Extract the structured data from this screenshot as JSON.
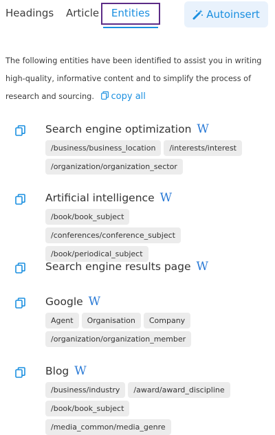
{
  "tabs": [
    {
      "label": "Headings"
    },
    {
      "label": "Article"
    },
    {
      "label": "Entities"
    }
  ],
  "autoinsert": {
    "label": "Autoinsert"
  },
  "intro": {
    "text": "The following entities have been identified to assist you in writing high-quality, informative content and to simplify the process of research and sourcing.",
    "copy_all": "copy all"
  },
  "wiki_label": "W",
  "entities": [
    {
      "name": "Search engine optimization",
      "tags": [
        "/business/business_location",
        "/interests/interest",
        "/organization/organization_sector"
      ]
    },
    {
      "name": "Artificial intelligence",
      "tags": [
        "/book/book_subject",
        "/conferences/conference_subject",
        "/book/periodical_subject"
      ]
    },
    {
      "name": "Search engine results page",
      "tags": []
    },
    {
      "name": "Google",
      "tags": [
        "Agent",
        "Organisation",
        "Company",
        "/organization/organization_member"
      ]
    },
    {
      "name": "Blog",
      "tags": [
        "/business/industry",
        "/award/award_discipline",
        "/book/book_subject",
        "/media_common/media_genre"
      ]
    }
  ],
  "colors": {
    "accent": "#1a8fe0",
    "active_outline": "#5b2b86",
    "tag_bg": "#ececec",
    "button_bg": "#e9f2fc"
  }
}
